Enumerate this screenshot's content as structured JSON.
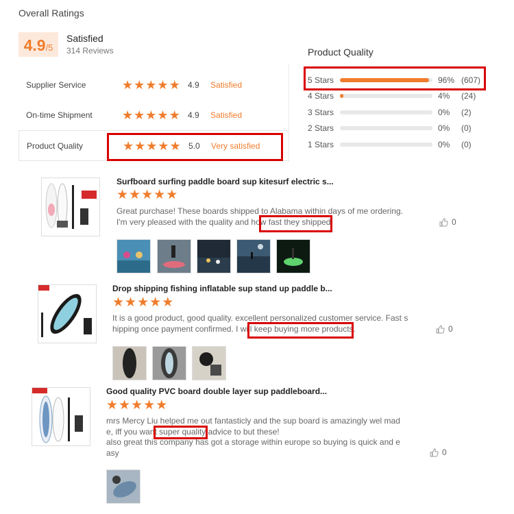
{
  "overall": {
    "title": "Overall Ratings",
    "score": "4.9",
    "score_suffix": "/5",
    "status": "Satisfied",
    "reviews": "314 Reviews"
  },
  "ratings": [
    {
      "label": "Supplier Service",
      "score": "4.9",
      "status": "Satisfied",
      "stars": 5
    },
    {
      "label": "On-time Shipment",
      "score": "4.9",
      "status": "Satisfied",
      "stars": 5
    },
    {
      "label": "Product Quality",
      "score": "5.0",
      "status": "Very satisfied",
      "stars": 5
    }
  ],
  "product_quality": {
    "title": "Product Quality",
    "distribution": [
      {
        "label": "5 Stars",
        "percent": "96%",
        "count": "(607)",
        "fill": 0.96
      },
      {
        "label": "4 Stars",
        "percent": "4%",
        "count": "(24)",
        "fill": 0.04
      },
      {
        "label": "3 Stars",
        "percent": "0%",
        "count": "(2)",
        "fill": 0
      },
      {
        "label": "2 Stars",
        "percent": "0%",
        "count": "(0)",
        "fill": 0
      },
      {
        "label": "1 Stars",
        "percent": "0%",
        "count": "(0)",
        "fill": 0
      }
    ]
  },
  "reviews": [
    {
      "title": "Surfboard surfing paddle board sup kitesurf electric s...",
      "lines": [
        "Great purchase! These boards shipped to Alabama within days of me ordering.",
        "I'm very pleased with the quality and how fast they shipped!"
      ],
      "likes": "0",
      "photo_count": 5
    },
    {
      "title": "Drop shipping fishing inflatable sup stand up paddle b...",
      "lines": [
        "It is a good product, good quality. excellent personalized customer service. Fast s",
        "hipping once payment confirmed. I will keep buying more products."
      ],
      "likes": "0",
      "photo_count": 3
    },
    {
      "title": "Good quality PVC board double layer sup paddleboard...",
      "lines": [
        "mrs Mercy Liu helped me out fantasticly and the sup board is amazingly wel mad",
        "e, iff you want super quality advice to but these!",
        "also great this company has got a storage within europe so buying is quick and e",
        "asy"
      ],
      "likes": "0",
      "photo_count": 1
    }
  ],
  "colors": {
    "accent": "#f07d2d",
    "highlight": "#d90000",
    "score_bg": "#fde9dc"
  }
}
